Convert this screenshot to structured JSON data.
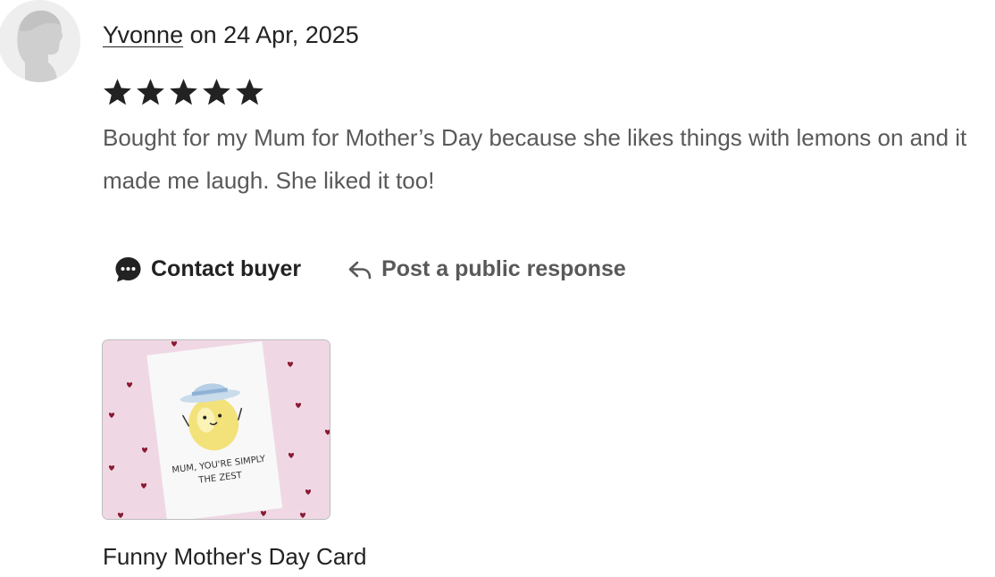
{
  "review": {
    "reviewer_name": "Yvonne",
    "date_text": " on 24 Apr, 2025",
    "rating": 5,
    "rating_max": 5,
    "text": "Bought for my Mum for Mother’s Day because she likes things with lemons on and it made me laugh. She liked it too!"
  },
  "actions": {
    "contact_label": "Contact buyer",
    "contact_icon": "speech-bubble-icon",
    "respond_label": "Post a public response",
    "respond_icon": "reply-arrow-icon"
  },
  "product": {
    "name": "Funny Mother's Day Card",
    "card_text_line1": "MUM, YOU'RE SIMPLY",
    "card_text_line2": "THE ZEST"
  },
  "colors": {
    "text_primary": "#222222",
    "text_secondary": "#595959",
    "star": "#222222",
    "card_background": "#efd8e4",
    "heart": "#8a1a33"
  }
}
